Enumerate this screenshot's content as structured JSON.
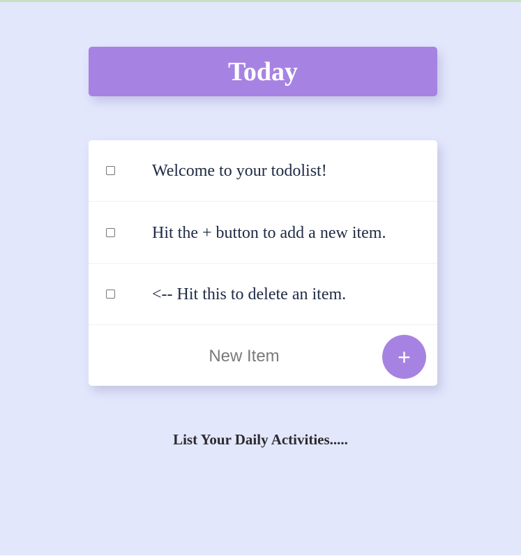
{
  "header": {
    "title": "Today"
  },
  "todo": {
    "items": [
      {
        "text": "Welcome to your todolist!",
        "checked": false
      },
      {
        "text": "Hit the + button to add a new item.",
        "checked": false
      },
      {
        "text": "<-- Hit this to delete an item.",
        "checked": false
      }
    ],
    "new_item": {
      "placeholder": "New Item",
      "value": ""
    },
    "add_button_label": "+"
  },
  "footer": {
    "text": "List Your Daily Activities....."
  },
  "colors": {
    "background": "#e3e7fc",
    "accent": "#a683e3",
    "card": "#ffffff",
    "item_text": "#1e2a44"
  }
}
